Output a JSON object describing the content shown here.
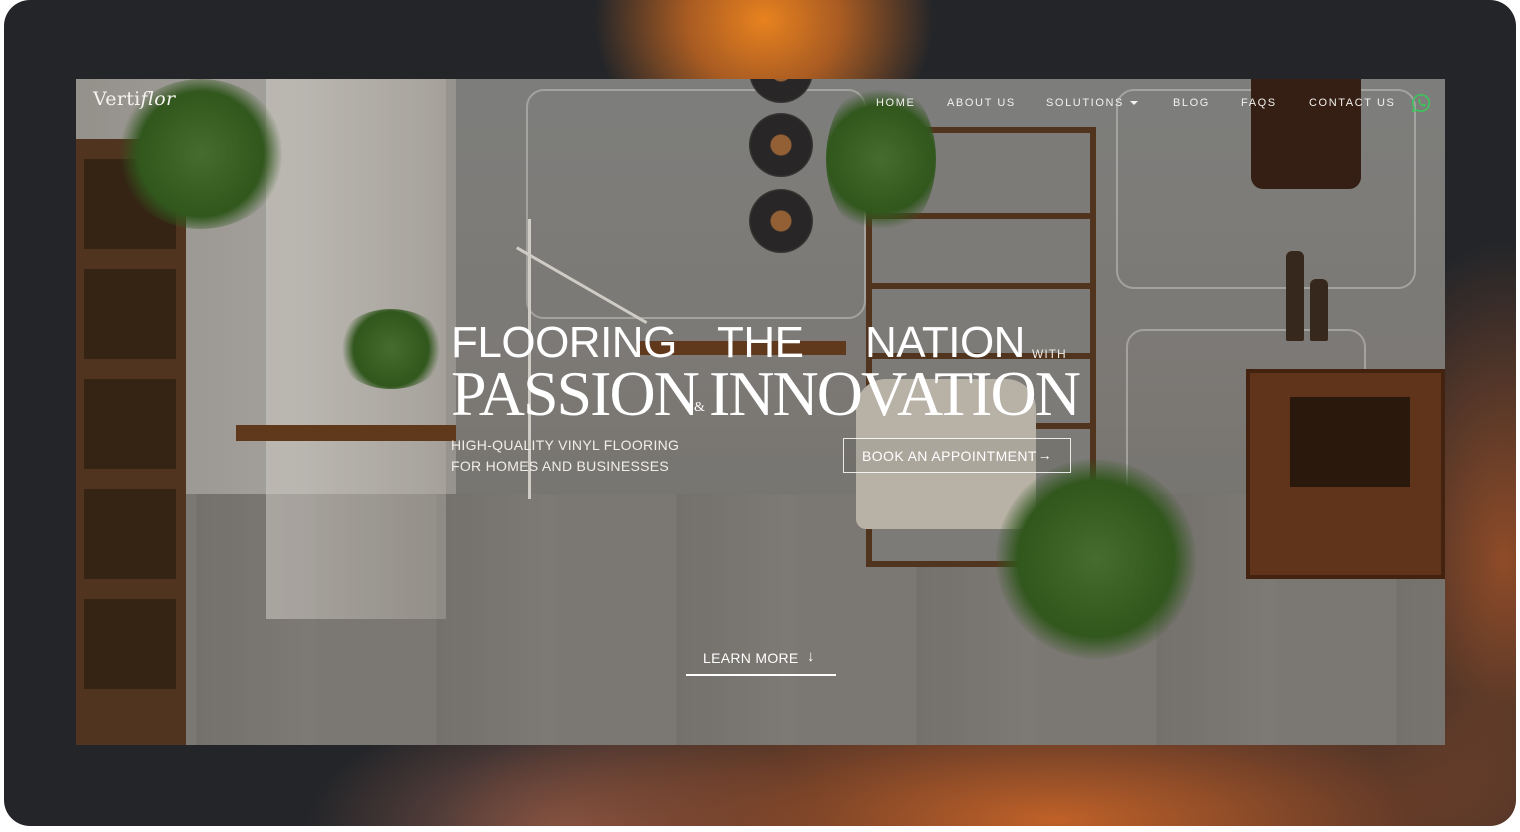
{
  "brand": {
    "logo_regular": "Verti",
    "logo_italic": "flor"
  },
  "nav": {
    "items": [
      "HOME",
      "ABOUT US",
      "SOLUTIONS",
      "BLOG",
      "FAQS",
      "CONTACT US"
    ],
    "contact_icon": "whatsapp-icon"
  },
  "hero": {
    "line1_word1": "FLOORING",
    "line1_word2": "THE",
    "line1_word3": "NATION",
    "line1_small": "WITH",
    "line2_left": "PASSION",
    "line2_amp": "&",
    "line2_right": "INNOVATION",
    "sub_line1": "HIGH-QUALITY VINYL FLOORING",
    "sub_line2": "FOR HOMES AND BUSINESSES",
    "cta_label": "BOOK  AN  APPOINTMENT",
    "cta_arrow": "→",
    "learn_label": "LEARN  MORE",
    "learn_arrow": "↓"
  },
  "colors": {
    "frame_dark": "#232529",
    "frame_orange": "#e8821f",
    "whatsapp_green": "#3fc35b",
    "text": "#ffffff"
  }
}
